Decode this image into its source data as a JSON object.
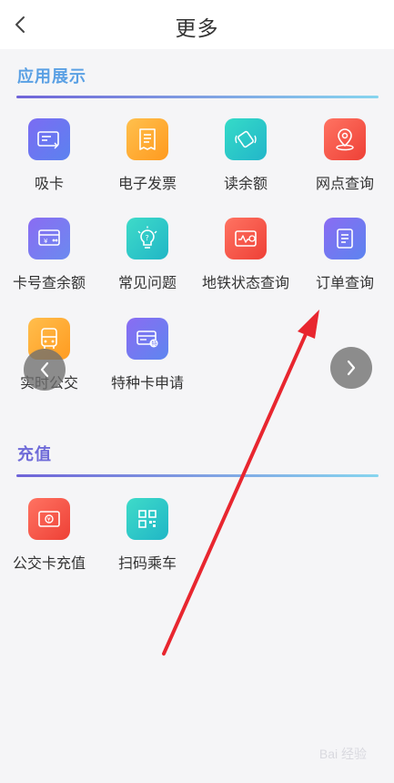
{
  "header": {
    "title": "更多"
  },
  "sections": [
    {
      "title": "应用展示",
      "items": [
        {
          "label": "吸卡",
          "icon": "card-absorb-icon",
          "color_from": "#7b6cf2",
          "color_to": "#5b82f0"
        },
        {
          "label": "电子发票",
          "icon": "invoice-icon",
          "color_from": "#ffb347",
          "color_to": "#ff9a1f"
        },
        {
          "label": "读余额",
          "icon": "nfc-read-icon",
          "color_from": "#2fd3c5",
          "color_to": "#22b6c9"
        },
        {
          "label": "网点查询",
          "icon": "location-pin-icon",
          "color_from": "#ff6a5c",
          "color_to": "#f0453d"
        },
        {
          "label": "卡号查余额",
          "icon": "card-balance-icon",
          "color_from": "#7a6cf2",
          "color_to": "#6b8af0"
        },
        {
          "label": "常见问题",
          "icon": "lightbulb-icon",
          "color_from": "#3bd5c8",
          "color_to": "#24b9c6"
        },
        {
          "label": "地铁状态查询",
          "icon": "subway-status-icon",
          "color_from": "#ff6b5d",
          "color_to": "#ef4338"
        },
        {
          "label": "订单查询",
          "icon": "order-icon",
          "color_from": "#7a6cf2",
          "color_to": "#5c84f0"
        },
        {
          "label": "实时公交",
          "icon": "bus-icon",
          "color_from": "#ffb347",
          "color_to": "#ff9b20"
        },
        {
          "label": "特种卡申请",
          "icon": "special-card-icon",
          "color_from": "#7a6cf2",
          "color_to": "#5e86f0"
        }
      ]
    },
    {
      "title": "充值",
      "items": [
        {
          "label": "公交卡充值",
          "icon": "bus-card-recharge-icon",
          "color_from": "#ff6b5d",
          "color_to": "#ef4338"
        },
        {
          "label": "扫码乘车",
          "icon": "qr-code-icon",
          "color_from": "#3bd5c8",
          "color_to": "#22b6c9"
        }
      ]
    }
  ],
  "watermark": "Bai 经验"
}
